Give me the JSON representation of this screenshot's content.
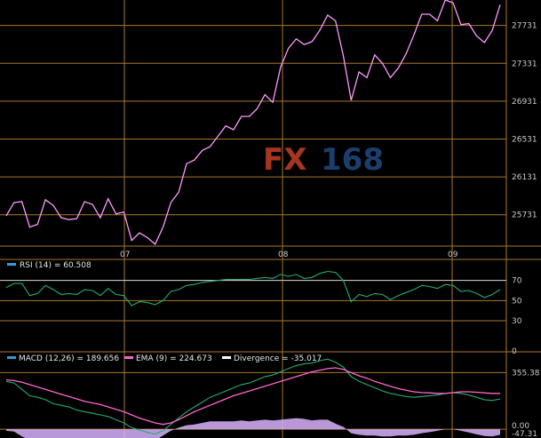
{
  "watermark": {
    "brand_a": "FX",
    "brand_b": "168"
  },
  "colors": {
    "background": "#000000",
    "grid": "#a8782c",
    "price": "#ff99ff",
    "rsi": "#1fae77",
    "rsi_ref": "#d8d8d8",
    "macd": "#1fae77",
    "ema": "#ff66cc",
    "divergence": "#d9b3ff",
    "legend_marker": "#2d9fd8",
    "legend_marker_ema": "#ff66cc",
    "legend_marker_div": "#ffffff"
  },
  "chart_data": [
    {
      "type": "line",
      "panel": "price",
      "ylim": [
        25400,
        28000
      ],
      "y_ticks": [
        25731,
        26131,
        26531,
        26931,
        27331,
        27731
      ],
      "x_ticks": [
        "07",
        "08",
        "09"
      ],
      "series": [
        {
          "values": [
            25720,
            25860,
            25870,
            25600,
            25630,
            25890,
            25830,
            25700,
            25680,
            25690,
            25870,
            25840,
            25700,
            25900,
            25740,
            25760,
            25460,
            25540,
            25490,
            25420,
            25600,
            25860,
            25970,
            26270,
            26310,
            26410,
            26450,
            26560,
            26670,
            26630,
            26770,
            26770,
            26850,
            27000,
            26920,
            27290,
            27490,
            27590,
            27530,
            27560,
            27680,
            27840,
            27780,
            27410,
            26940,
            27240,
            27180,
            27420,
            27330,
            27180,
            27280,
            27430,
            27630,
            27850,
            27850,
            27780,
            28000,
            27970,
            27740,
            27750,
            27620,
            27550,
            27680,
            27950
          ]
        }
      ]
    },
    {
      "type": "line",
      "panel": "rsi",
      "legend": {
        "label": "RSI (14)",
        "value": "60.508"
      },
      "y_ticks": [
        0,
        30,
        50,
        70
      ],
      "reference_levels": [
        70,
        50,
        30
      ],
      "ylim": [
        0,
        90
      ],
      "series": [
        {
          "name": "RSI (14)",
          "values": [
            63,
            67,
            67,
            55,
            57,
            65,
            61,
            56,
            57,
            56,
            61,
            60,
            55,
            62,
            56,
            55,
            45,
            49,
            48,
            46,
            50,
            59,
            61,
            65,
            66,
            68,
            69,
            70,
            71,
            71,
            71,
            71,
            72,
            73,
            72,
            76,
            74,
            76,
            72,
            73,
            77,
            79,
            78,
            70,
            49,
            56,
            54,
            57,
            56,
            51,
            55,
            58,
            61,
            65,
            64,
            62,
            66,
            65,
            59,
            60,
            57,
            53,
            56,
            61
          ]
        }
      ]
    },
    {
      "type": "line",
      "panel": "macd",
      "legend": [
        {
          "label": "MACD (12,26)",
          "value": "189.656"
        },
        {
          "label": "EMA (9)",
          "value": "224.673"
        },
        {
          "label": "Divergence",
          "value": "-35.017"
        }
      ],
      "y_ticks": [
        "355.38",
        "0.00",
        "-47.31"
      ],
      "ylim": [
        -55,
        480
      ],
      "series": [
        {
          "name": "MACD (12,26)",
          "values": [
            300,
            290,
            250,
            210,
            200,
            185,
            160,
            150,
            140,
            120,
            110,
            100,
            90,
            80,
            60,
            40,
            10,
            -5,
            -20,
            -30,
            -10,
            30,
            70,
            110,
            140,
            170,
            200,
            220,
            240,
            260,
            280,
            290,
            310,
            330,
            340,
            360,
            380,
            400,
            410,
            415,
            430,
            440,
            420,
            390,
            330,
            300,
            280,
            260,
            240,
            225,
            215,
            205,
            200,
            205,
            210,
            215,
            225,
            230,
            225,
            215,
            200,
            185,
            180,
            190
          ]
        },
        {
          "name": "EMA (9)",
          "values": [
            310,
            305,
            295,
            280,
            265,
            250,
            235,
            220,
            205,
            190,
            175,
            165,
            155,
            140,
            125,
            110,
            90,
            70,
            55,
            40,
            30,
            40,
            60,
            85,
            110,
            130,
            150,
            170,
            190,
            210,
            225,
            240,
            255,
            270,
            285,
            300,
            315,
            330,
            345,
            360,
            370,
            380,
            385,
            375,
            355,
            335,
            320,
            300,
            285,
            270,
            255,
            245,
            235,
            230,
            228,
            225,
            225,
            230,
            235,
            235,
            232,
            228,
            225,
            225
          ]
        },
        {
          "name": "Divergence",
          "values": [
            -10,
            -15,
            -45,
            -70,
            -65,
            -65,
            -75,
            -70,
            -65,
            -70,
            -65,
            -65,
            -65,
            -60,
            -65,
            -70,
            -80,
            -75,
            -75,
            -70,
            -40,
            -10,
            10,
            25,
            30,
            40,
            50,
            50,
            50,
            50,
            55,
            50,
            55,
            60,
            55,
            60,
            65,
            70,
            65,
            55,
            60,
            60,
            35,
            15,
            -25,
            -35,
            -40,
            -40,
            -45,
            -45,
            -40,
            -40,
            -35,
            -25,
            -18,
            -10,
            0,
            0,
            -10,
            -20,
            -32,
            -43,
            -45,
            -35
          ]
        }
      ]
    }
  ]
}
